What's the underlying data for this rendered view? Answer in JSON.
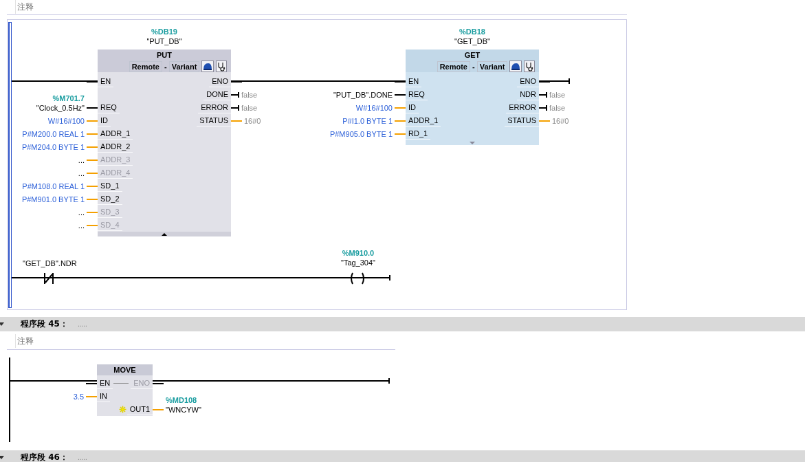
{
  "network_44": {
    "comment": {
      "placeholder": "注释"
    },
    "blocks": [
      {
        "instance": "%DB19",
        "instance_name": "\"PUT_DB\"",
        "title": "PUT",
        "type_params": [
          "Remote",
          "Variant"
        ],
        "separator": "-",
        "selected": false,
        "expanded": true,
        "rows": [
          {
            "left": {
              "pin": "EN",
              "kind": "power",
              "used": true
            },
            "right": {
              "pin": "ENO",
              "kind": "power",
              "used": true
            }
          },
          {
            "right": {
              "pin": "DONE",
              "kind": "bool",
              "used": true,
              "operand": {
                "text": "false",
                "kind": "monitor"
              }
            }
          },
          {
            "left": {
              "pin": "REQ",
              "kind": "bool",
              "used": true,
              "operand": {
                "text": "\"Clock_0.5Hz\"",
                "kind": "tag",
                "address": "%M701.7"
              }
            },
            "right": {
              "pin": "ERROR",
              "kind": "bool",
              "used": true,
              "operand": {
                "text": "false",
                "kind": "monitor"
              }
            }
          },
          {
            "left": {
              "pin": "ID",
              "kind": "value",
              "used": true,
              "operand": {
                "text": "W#16#100",
                "kind": "constant"
              }
            },
            "right": {
              "pin": "STATUS",
              "kind": "value",
              "used": true,
              "operand": {
                "text": "16#0",
                "kind": "monitor"
              }
            }
          },
          {
            "left": {
              "pin": "ADDR_1",
              "kind": "value",
              "used": true,
              "operand": {
                "text": "P#M200.0 REAL 1",
                "kind": "constant"
              }
            }
          },
          {
            "left": {
              "pin": "ADDR_2",
              "kind": "value",
              "used": true,
              "operand": {
                "text": "P#M204.0 BYTE 1",
                "kind": "constant"
              }
            }
          },
          {
            "left": {
              "pin": "ADDR_3",
              "kind": "value",
              "used": false,
              "operand": {
                "text": "...",
                "kind": "tag"
              }
            }
          },
          {
            "left": {
              "pin": "ADDR_4",
              "kind": "value",
              "used": false,
              "operand": {
                "text": "...",
                "kind": "tag"
              }
            }
          },
          {
            "left": {
              "pin": "SD_1",
              "kind": "value",
              "used": true,
              "operand": {
                "text": "P#M108.0 REAL 1",
                "kind": "constant"
              }
            }
          },
          {
            "left": {
              "pin": "SD_2",
              "kind": "value",
              "used": true,
              "operand": {
                "text": "P#M901.0 BYTE 1",
                "kind": "constant"
              }
            }
          },
          {
            "left": {
              "pin": "SD_3",
              "kind": "value",
              "used": false,
              "operand": {
                "text": "...",
                "kind": "tag"
              }
            }
          },
          {
            "left": {
              "pin": "SD_4",
              "kind": "value",
              "used": false,
              "operand": {
                "text": "...",
                "kind": "tag"
              }
            }
          }
        ]
      },
      {
        "instance": "%DB18",
        "instance_name": "\"GET_DB\"",
        "title": "GET",
        "type_params": [
          "Remote",
          "Variant"
        ],
        "separator": "-",
        "selected": true,
        "expanded": false,
        "rows": [
          {
            "left": {
              "pin": "EN",
              "kind": "power",
              "used": true
            },
            "right": {
              "pin": "ENO",
              "kind": "power",
              "used": true
            }
          },
          {
            "left": {
              "pin": "REQ",
              "kind": "bool",
              "used": true,
              "operand": {
                "text": "\"PUT_DB\".DONE",
                "kind": "tag"
              }
            },
            "right": {
              "pin": "NDR",
              "kind": "bool",
              "used": true,
              "operand": {
                "text": "false",
                "kind": "monitor"
              }
            }
          },
          {
            "left": {
              "pin": "ID",
              "kind": "value",
              "used": true,
              "operand": {
                "text": "W#16#100",
                "kind": "constant"
              }
            },
            "right": {
              "pin": "ERROR",
              "kind": "bool",
              "used": true,
              "operand": {
                "text": "false",
                "kind": "monitor"
              }
            }
          },
          {
            "left": {
              "pin": "ADDR_1",
              "kind": "value",
              "used": true,
              "operand": {
                "text": "P#I1.0 BYTE 1",
                "kind": "constant"
              }
            },
            "right": {
              "pin": "STATUS",
              "kind": "value",
              "used": true,
              "operand": {
                "text": "16#0",
                "kind": "monitor"
              }
            }
          },
          {
            "left": {
              "pin": "RD_1",
              "kind": "value",
              "used": true,
              "operand": {
                "text": "P#M905.0 BYTE 1",
                "kind": "constant"
              }
            }
          }
        ]
      }
    ],
    "rung": [
      {
        "kind": "nc_contact",
        "operand": "\"GET_DB\".NDR"
      },
      {
        "kind": "coil",
        "address": "%M910.0",
        "operand": "\"Tag_304\""
      }
    ]
  },
  "network_45": {
    "title": "程序段 45：",
    "dots": ".....",
    "expanded": true,
    "comment": {
      "placeholder": "注释"
    },
    "blocks": [
      {
        "title": "MOVE",
        "selected": false,
        "rows": [
          {
            "left": {
              "pin": "EN",
              "kind": "power",
              "used": true
            },
            "right": {
              "pin": "ENO",
              "kind": "power",
              "used": false
            },
            "passthrough": true
          },
          {
            "left": {
              "pin": "IN",
              "kind": "value",
              "used": true,
              "operand": {
                "text": "3.5",
                "kind": "constant"
              }
            }
          },
          {
            "right": {
              "pin": "OUT1",
              "kind": "value",
              "used": true,
              "add_icon": true,
              "operand": {
                "text": "\"WNCYW\"",
                "kind": "tag",
                "address": "%MD108"
              }
            }
          }
        ]
      }
    ]
  },
  "network_46": {
    "title": "程序段 46：",
    "dots": ".....",
    "expanded": true
  }
}
